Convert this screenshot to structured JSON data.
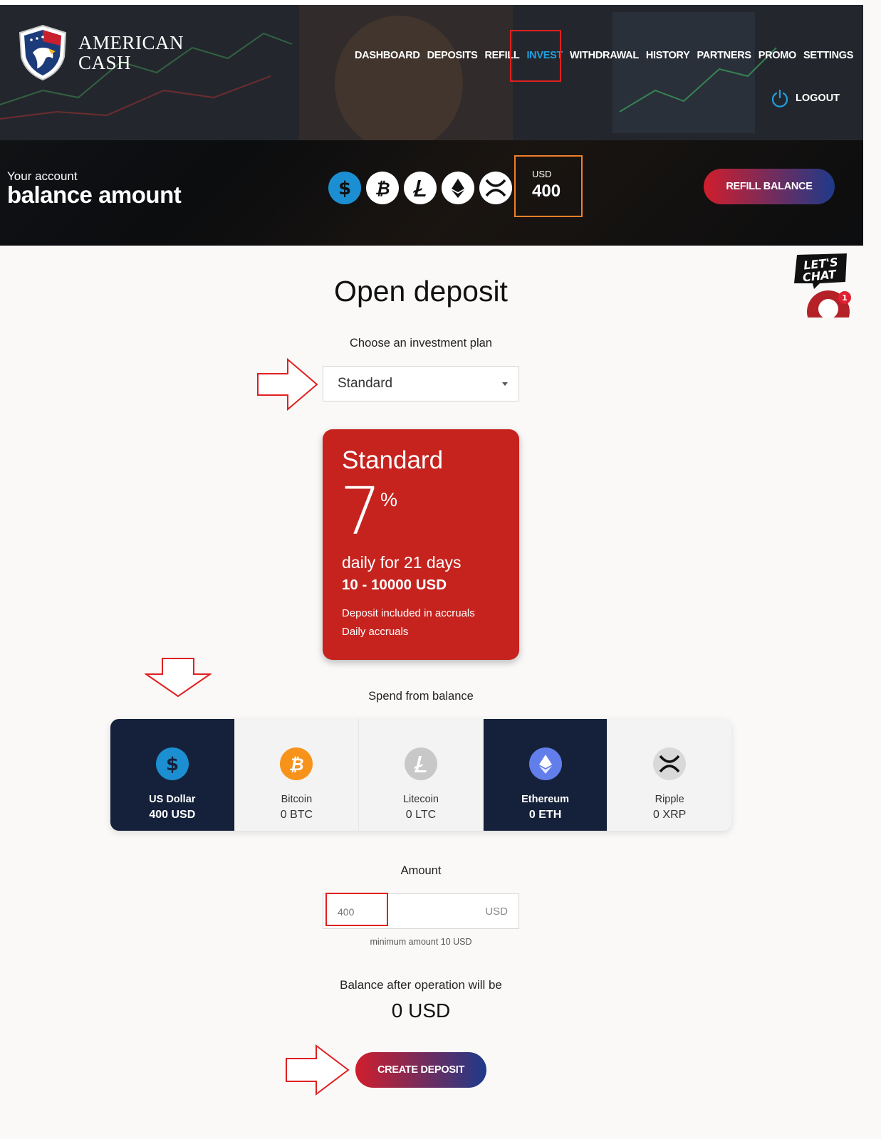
{
  "brand": {
    "line1": "AMERICAN",
    "line2": "CASH"
  },
  "nav": [
    {
      "label": "DASHBOARD"
    },
    {
      "label": "DEPOSITS"
    },
    {
      "label": "REFILL"
    },
    {
      "label": "INVEST",
      "active": true
    },
    {
      "label": "WITHDRAWAL"
    },
    {
      "label": "HISTORY"
    },
    {
      "label": "PARTNERS"
    },
    {
      "label": "PROMO"
    },
    {
      "label": "SETTINGS"
    }
  ],
  "logout_label": "LOGOUT",
  "account": {
    "label": "Your account",
    "title": "balance amount",
    "coins": [
      "usd-coin-icon",
      "bitcoin-icon",
      "litecoin-icon",
      "ethereum-icon",
      "ripple-icon"
    ],
    "balance_currency": "USD",
    "balance_value": "400",
    "refill_label": "REFILL BALANCE"
  },
  "chat": {
    "label": "LET'S CHAT",
    "badge": "1"
  },
  "page": {
    "title": "Open deposit",
    "plan_label": "Choose an investment plan",
    "plan_selected": "Standard"
  },
  "plan_card": {
    "name": "Standard",
    "rate": "7",
    "percent": "%",
    "period": "daily for 21 days",
    "range": "10 - 10000 USD",
    "note1": "Deposit included in accruals",
    "note2": "Daily accruals"
  },
  "spend": {
    "label": "Spend from balance",
    "wallets": [
      {
        "name": "US Dollar",
        "amount": "400 USD",
        "icon": "usd-icon",
        "color": "#1b8fd2"
      },
      {
        "name": "Bitcoin",
        "amount": "0 BTC",
        "icon": "bitcoin-icon",
        "color": "#f7931a"
      },
      {
        "name": "Litecoin",
        "amount": "0 LTC",
        "icon": "litecoin-icon",
        "color": "#c8c8c8"
      },
      {
        "name": "Ethereum",
        "amount": "0 ETH",
        "icon": "ethereum-icon",
        "color": "#627eea"
      },
      {
        "name": "Ripple",
        "amount": "0 XRP",
        "icon": "ripple-icon",
        "color": "#d9d9d9"
      }
    ]
  },
  "amount": {
    "label": "Amount",
    "value": "400",
    "currency": "USD",
    "hint": "minimum amount 10 USD"
  },
  "after": {
    "label": "Balance after operation will be",
    "value": "0 USD"
  },
  "create_label": "CREATE DEPOSIT",
  "colors": {
    "accent_blue": "#1fa0e0",
    "plan_red": "#c6231f",
    "highlight_red": "#e02020",
    "highlight_orange": "#f07f2a",
    "wallet_dark": "#15213a"
  }
}
